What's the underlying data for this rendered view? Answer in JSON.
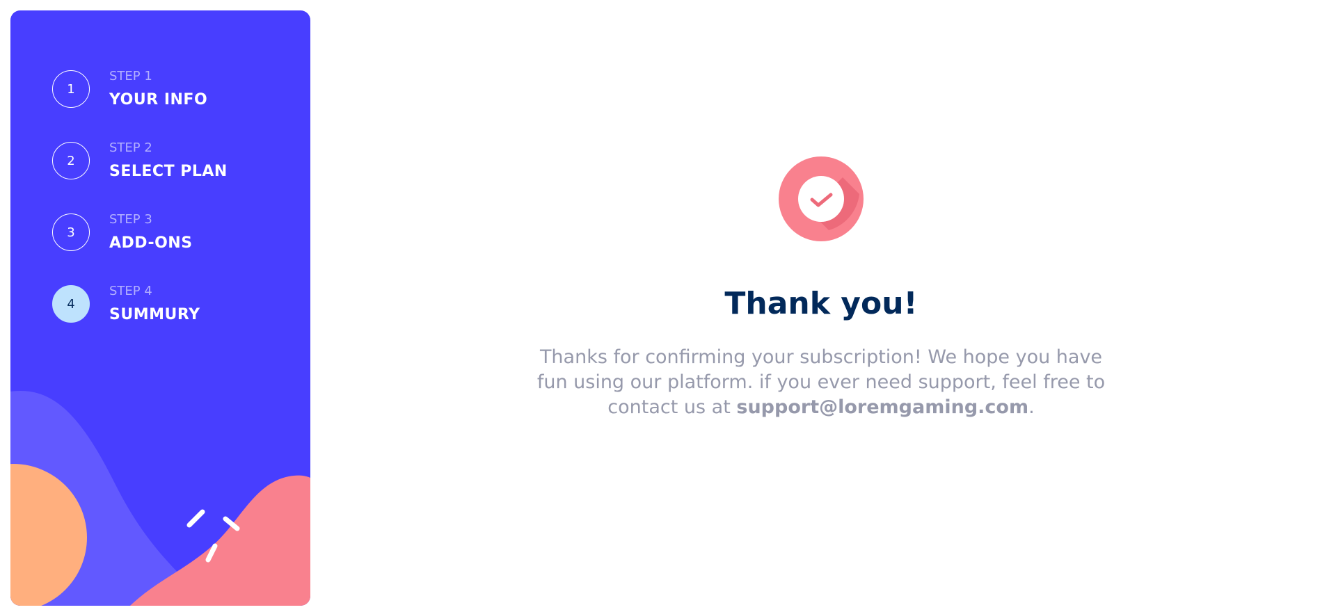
{
  "sidebar": {
    "steps": [
      {
        "number": "1",
        "kicker": "STEP 1",
        "title": "YOUR INFO",
        "active": false
      },
      {
        "number": "2",
        "kicker": "STEP 2",
        "title": "SELECT PLAN",
        "active": false
      },
      {
        "number": "3",
        "kicker": "STEP 3",
        "title": "ADD-ONS",
        "active": false
      },
      {
        "number": "4",
        "kicker": "STEP 4",
        "title": "SUMMURY",
        "active": true
      }
    ]
  },
  "confirmation": {
    "icon": "checkmark-circle-icon",
    "title": "Thank you!",
    "message_part1": "Thanks for confirming your subscription! We hope you have fun using our platform. if you ever need support, feel free to contact us at ",
    "email": "support@loremgaming.com",
    "message_part2": "."
  },
  "colors": {
    "sidebar_bg": "#483eff",
    "active_step_bg": "#bee2fd",
    "title_color": "#02295a",
    "text_color": "#9699ab",
    "accent_pink": "#f9818e",
    "accent_orange": "#ffaf7e",
    "accent_purple": "#6259ff"
  }
}
